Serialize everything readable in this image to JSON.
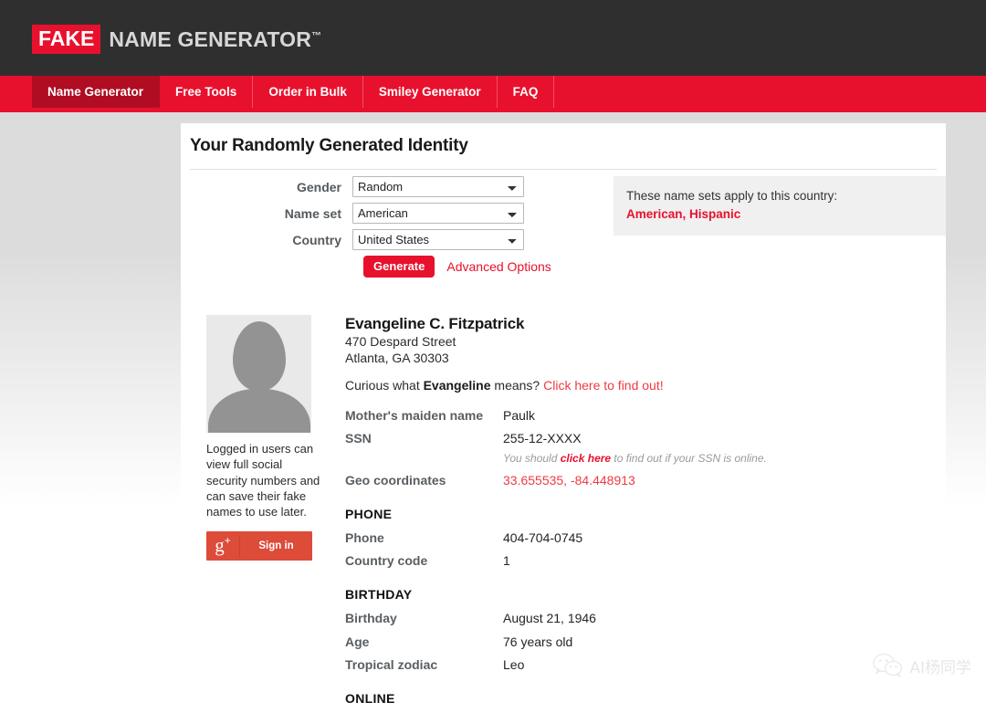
{
  "header": {
    "logo_fake": "FAKE",
    "logo_rest": "NAME GENERATOR",
    "logo_tm": "™"
  },
  "nav": {
    "items": [
      {
        "label": "Name Generator",
        "active": true
      },
      {
        "label": "Free Tools",
        "active": false
      },
      {
        "label": "Order in Bulk",
        "active": false
      },
      {
        "label": "Smiley Generator",
        "active": false
      },
      {
        "label": "FAQ",
        "active": false
      }
    ]
  },
  "panel": {
    "title": "Your Randomly Generated Identity"
  },
  "form": {
    "gender": {
      "label": "Gender",
      "value": "Random"
    },
    "nameset": {
      "label": "Name set",
      "value": "American"
    },
    "country": {
      "label": "Country",
      "value": "United States"
    },
    "generate_label": "Generate",
    "advanced_label": "Advanced Options"
  },
  "nameset_notice": {
    "intro": "These name sets apply to this country:",
    "list": "American, Hispanic"
  },
  "sidebar": {
    "note": "Logged in users can view full social security numbers and can save their fake names to use later.",
    "gplus_icon": "g",
    "gplus_plus": "+",
    "gplus_label": "Sign in"
  },
  "identity": {
    "name": "Evangeline C. Fitzpatrick",
    "street": "470 Despard Street",
    "city_state_zip": "Atlanta, GA 30303",
    "meaning_prefix": "Curious what ",
    "meaning_name": "Evangeline",
    "meaning_suffix": " means? ",
    "meaning_link": "Click here to find out!"
  },
  "details": {
    "rows": [
      {
        "label": "Mother's maiden name",
        "value": "Paulk",
        "red": false
      },
      {
        "label": "SSN",
        "value": "255-12-XXXX",
        "red": false
      },
      {
        "label": "Geo coordinates",
        "value": "33.655535, -84.448913",
        "red": true
      }
    ],
    "ssn_note_prefix": "You should ",
    "ssn_note_link": "click here",
    "ssn_note_suffix": " to find out if your SSN is online."
  },
  "sections": [
    {
      "heading": "PHONE",
      "rows": [
        {
          "label": "Phone",
          "value": "404-704-0745"
        },
        {
          "label": "Country code",
          "value": "1"
        }
      ]
    },
    {
      "heading": "BIRTHDAY",
      "rows": [
        {
          "label": "Birthday",
          "value": "August 21, 1946"
        },
        {
          "label": "Age",
          "value": "76 years old"
        },
        {
          "label": "Tropical zodiac",
          "value": "Leo"
        }
      ]
    },
    {
      "heading": "ONLINE",
      "rows": []
    }
  ],
  "watermark": {
    "text": "AI杨同学",
    "icon": "wechat-icon"
  },
  "colors": {
    "brand_red": "#e8112d",
    "active_tab_red": "#b00d22",
    "header_dark": "#2f2f2f",
    "link_red": "#ee3b42",
    "gplus_red": "#dd4b39"
  }
}
